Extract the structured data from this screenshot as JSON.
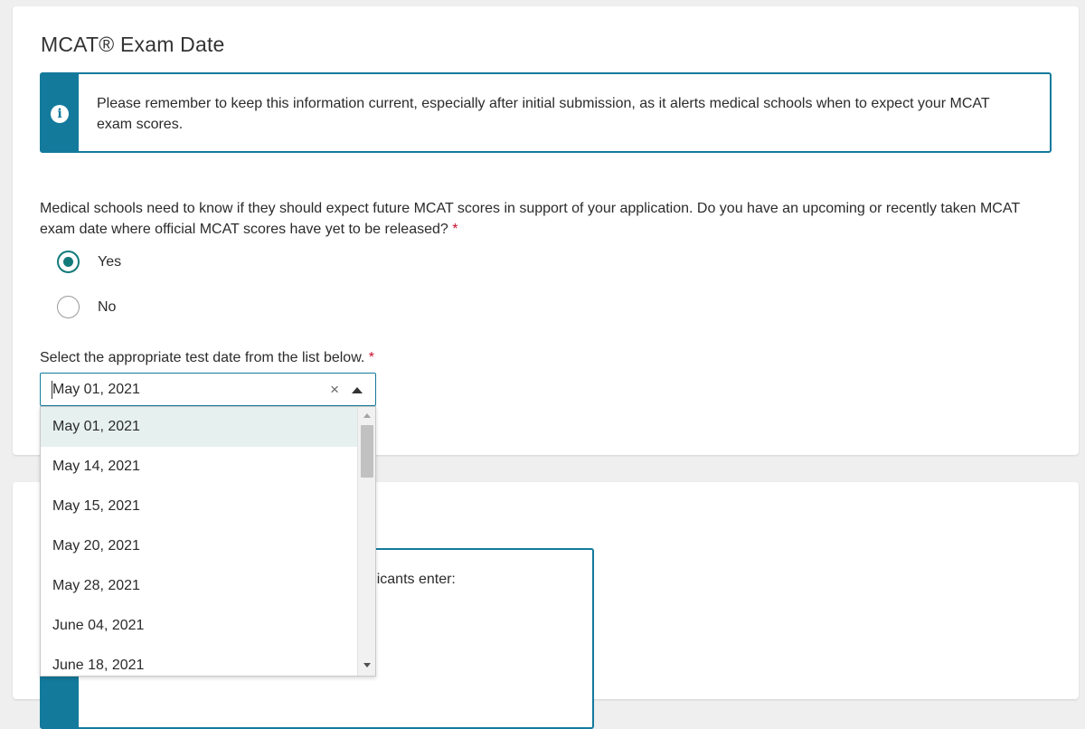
{
  "section": {
    "title": "MCAT® Exam Date",
    "info_message": "Please remember to keep this information current, especially after initial submission, as it alerts medical schools when to expect your MCAT exam scores.",
    "question": "Medical schools need to know if they should expect future MCAT scores in support of your application. Do you have an upcoming or recently taken MCAT exam date where official MCAT scores have yet to be released?",
    "required_mark": "*",
    "radio_options": [
      {
        "label": "Yes",
        "selected": true
      },
      {
        "label": "No",
        "selected": false
      }
    ],
    "select_label": "Select the appropriate test date from the list below.",
    "select_value": "May 01, 2021",
    "clear_glyph": "×",
    "dropdown_options": [
      "May 01, 2021",
      "May 14, 2021",
      "May 15, 2021",
      "May 20, 2021",
      "May 28, 2021",
      "June 04, 2021",
      "June 18, 2021"
    ]
  },
  "next_section": {
    "info_partial": "ts some applicants enter:"
  },
  "colors": {
    "accent": "#137a9c",
    "radio": "#137a7a",
    "required": "#c8102e",
    "option_highlight": "#e6f0ef"
  }
}
